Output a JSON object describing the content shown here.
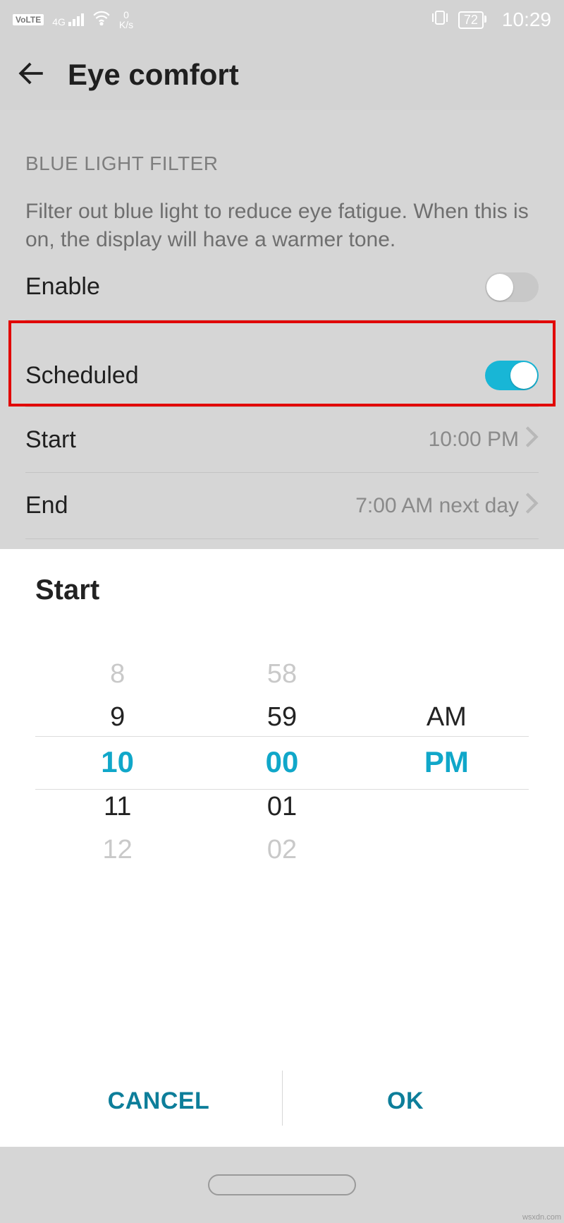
{
  "status": {
    "volte": "VoLTE",
    "net_gen": "4G",
    "speed_num": "0",
    "speed_unit": "K/s",
    "battery": "72",
    "time": "10:29"
  },
  "header": {
    "title": "Eye comfort"
  },
  "section": {
    "heading": "BLUE LIGHT FILTER",
    "description": "Filter out blue light to reduce eye fatigue. When this is on, the display will have a warmer tone."
  },
  "rows": {
    "enable_label": "Enable",
    "scheduled_label": "Scheduled",
    "start_label": "Start",
    "start_value": "10:00 PM",
    "end_label": "End",
    "end_value": "7:00 AM next day"
  },
  "picker": {
    "title": "Start",
    "hours": {
      "fade_top": "8",
      "above": "9",
      "selected": "10",
      "below": "11",
      "fade_bot": "12"
    },
    "minutes": {
      "fade_top": "58",
      "above": "59",
      "selected": "00",
      "below": "01",
      "fade_bot": "02"
    },
    "ampm": {
      "above": "AM",
      "selected": "PM"
    },
    "cancel": "CANCEL",
    "ok": "OK"
  },
  "attrib": "wsxdn.com"
}
